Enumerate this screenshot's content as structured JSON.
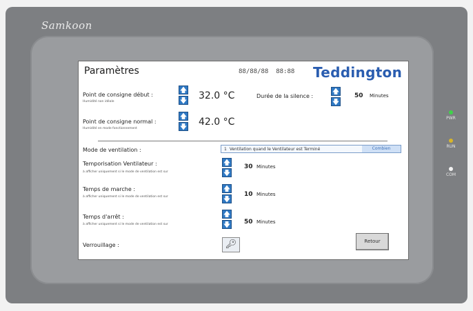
{
  "device": {
    "brand": "Samkoon",
    "leds": [
      {
        "label": "PWR",
        "color": "#3fd34a"
      },
      {
        "label": "RUN",
        "color": "#d8b52a"
      },
      {
        "label": "COM",
        "color": "#f2f2f2"
      }
    ]
  },
  "header": {
    "title": "Paramètres",
    "date": "88/88/88",
    "time": "88:88",
    "logo": "Teddington"
  },
  "setpoints": {
    "start": {
      "label": "Point de consigne début :",
      "sub": "Humidité non idéale",
      "value": "32.0 °C"
    },
    "normal": {
      "label": "Point de consigne normal :",
      "sub": "Humidité en mode fonctionnement",
      "value": "42.0 °C"
    },
    "silence": {
      "label": "Durée de la silence :",
      "value": "50",
      "unit": "Minutes"
    }
  },
  "ventilation": {
    "mode_label": "Mode de ventilation :",
    "mode_index": "1",
    "mode_value": "Ventilation quand le Ventilateur est Terminé",
    "mode_highlight": "Combien",
    "temp": {
      "label": "Temporisation Ventilateur :",
      "sub": "à afficher uniquement si le mode de ventilation est sur",
      "value": "30",
      "unit": "Minutes"
    },
    "run": {
      "label": "Temps de marche :",
      "sub": "à afficher uniquement si le mode de ventilation est sur",
      "value": "10",
      "unit": "Minutes"
    },
    "stop": {
      "label": "Temps d'arrêt :",
      "sub": "à afficher uniquement si le mode de ventilation est sur",
      "value": "50",
      "unit": "Minutes"
    }
  },
  "lock": {
    "label": "Verrouillage :"
  },
  "footer": {
    "back_label": "Retour"
  },
  "arrows": {
    "up": "🡅",
    "down": "🡇"
  }
}
